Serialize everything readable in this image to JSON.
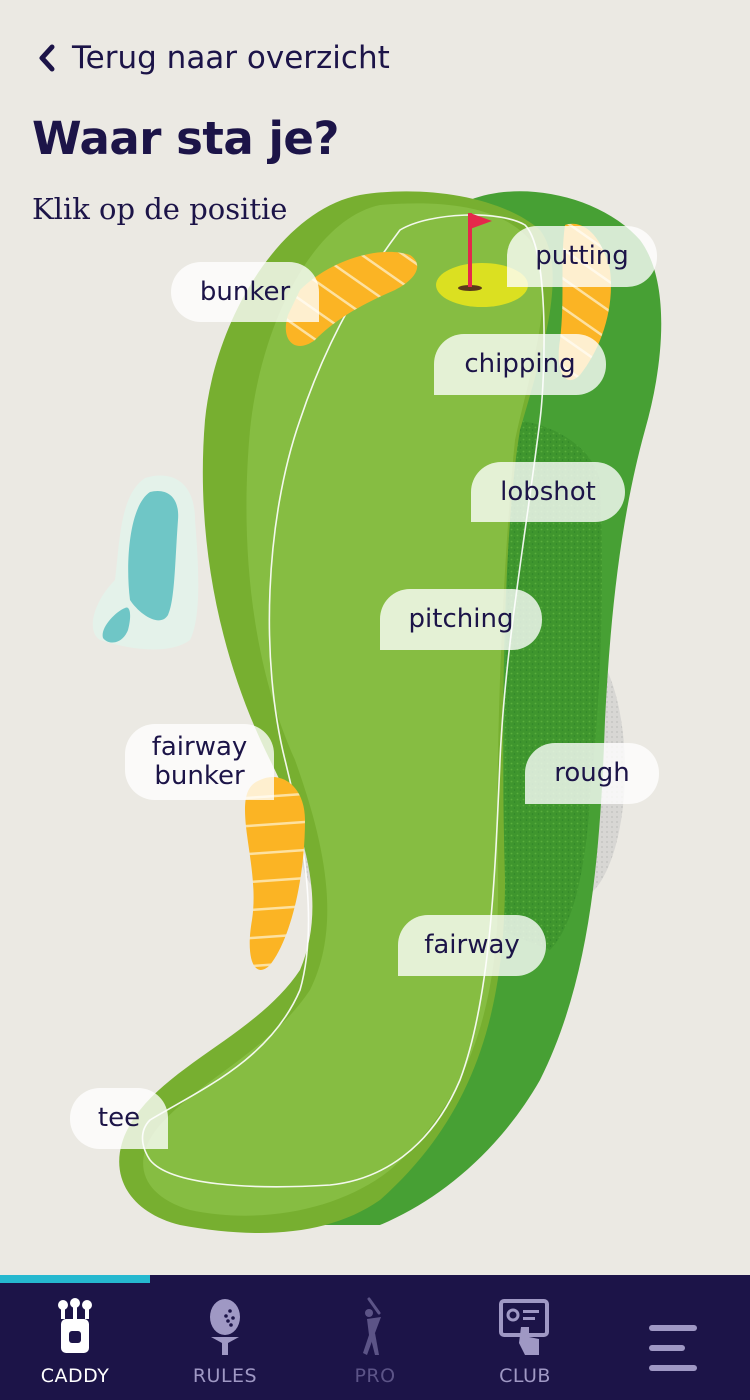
{
  "header": {
    "back_label": "Terug naar overzicht",
    "title": "Waar sta je?",
    "subtitle": "Klik op de positie"
  },
  "positions": [
    {
      "id": "bunker",
      "label": "bunker"
    },
    {
      "id": "putting",
      "label": "putting"
    },
    {
      "id": "chipping",
      "label": "chipping"
    },
    {
      "id": "lobshot",
      "label": "lobshot"
    },
    {
      "id": "pitching",
      "label": "pitching"
    },
    {
      "id": "fairway-bunker",
      "label": "fairway\nbunker"
    },
    {
      "id": "rough",
      "label": "rough"
    },
    {
      "id": "fairway",
      "label": "fairway"
    },
    {
      "id": "tee",
      "label": "tee"
    }
  ],
  "nav": {
    "items": [
      {
        "label": "CADDY",
        "icon": "golf-bag-icon",
        "active": true
      },
      {
        "label": "RULES",
        "icon": "golf-ball-tee-icon",
        "active": false
      },
      {
        "label": "PRO",
        "icon": "golfer-swing-icon",
        "active": false,
        "disabled": true
      },
      {
        "label": "CLUB",
        "icon": "club-card-icon",
        "active": false
      },
      {
        "label": "",
        "icon": "menu-icon",
        "active": false
      }
    ]
  },
  "colors": {
    "background": "#ebe9e3",
    "text": "#1c1448",
    "nav_bg": "#1c1448",
    "accent": "#25b8cf",
    "fairway": "#86bd42",
    "rough": "#47a034",
    "bunker": "#fbb424",
    "water": "#6fc6c6",
    "flag": "#e5284b"
  }
}
